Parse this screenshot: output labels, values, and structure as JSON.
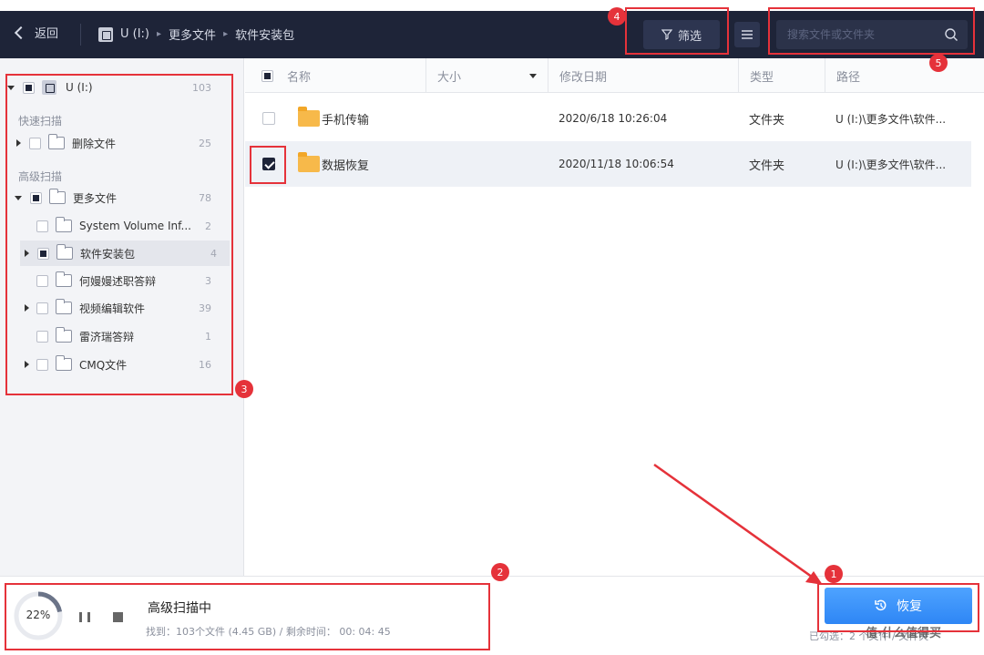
{
  "topbar": {
    "back_label": "返回",
    "breadcrumb": [
      "U (I:)",
      "更多文件",
      "软件安装包"
    ],
    "filter_label": "筛选",
    "search_placeholder": "搜索文件或文件夹"
  },
  "tree": {
    "root": {
      "label": "U (I:)",
      "count": "103"
    },
    "quick_scan_label": "快速扫描",
    "deleted": {
      "label": "删除文件",
      "count": "25"
    },
    "advanced_scan_label": "高级扫描",
    "more_files": {
      "label": "更多文件",
      "count": "78"
    },
    "children": [
      {
        "label": "System Volume Inf...",
        "count": "2"
      },
      {
        "label": "软件安装包",
        "count": "4"
      },
      {
        "label": "何嫚嫚述职答辩",
        "count": "3"
      },
      {
        "label": "视频编辑软件",
        "count": "39"
      },
      {
        "label": "雷济瑞答辩",
        "count": "1"
      },
      {
        "label": "CMQ文件",
        "count": "16"
      }
    ]
  },
  "table": {
    "headers": {
      "name": "名称",
      "size": "大小",
      "modified": "修改日期",
      "type": "类型",
      "path": "路径"
    },
    "rows": [
      {
        "name": "手机传输",
        "size": "",
        "modified": "2020/6/18 10:26:04",
        "type": "文件夹",
        "path": "U (I:)\\更多文件\\软件...",
        "checked": false
      },
      {
        "name": "数据恢复",
        "size": "",
        "modified": "2020/11/18 10:06:54",
        "type": "文件夹",
        "path": "U (I:)\\更多文件\\软件...",
        "checked": true
      }
    ]
  },
  "scan": {
    "progress_percent": 22,
    "progress_label": "22%",
    "title": "高级扫描中",
    "info": "找到：103个文件 (4.45 GB) / 剩余时间： 00: 04: 45"
  },
  "recover_label": "恢复",
  "selected_info": "已勾选：2 个文件 / 文件夹",
  "watermark": "值·什么值得买",
  "annotations": [
    "1",
    "2",
    "3",
    "4",
    "5"
  ],
  "colors": {
    "topbar": "#1e2438",
    "accent": "#2e86f5",
    "annotation": "#e5323a",
    "folder": "#f7b94a"
  }
}
